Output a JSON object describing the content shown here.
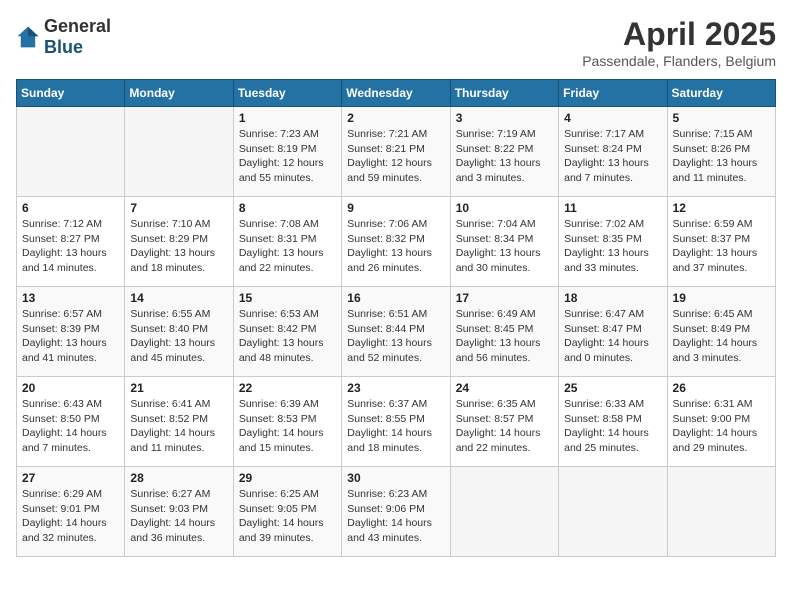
{
  "logo": {
    "general": "General",
    "blue": "Blue"
  },
  "title": "April 2025",
  "subtitle": "Passendale, Flanders, Belgium",
  "weekdays": [
    "Sunday",
    "Monday",
    "Tuesday",
    "Wednesday",
    "Thursday",
    "Friday",
    "Saturday"
  ],
  "weeks": [
    [
      {
        "day": "",
        "detail": ""
      },
      {
        "day": "",
        "detail": ""
      },
      {
        "day": "1",
        "detail": "Sunrise: 7:23 AM\nSunset: 8:19 PM\nDaylight: 12 hours\nand 55 minutes."
      },
      {
        "day": "2",
        "detail": "Sunrise: 7:21 AM\nSunset: 8:21 PM\nDaylight: 12 hours\nand 59 minutes."
      },
      {
        "day": "3",
        "detail": "Sunrise: 7:19 AM\nSunset: 8:22 PM\nDaylight: 13 hours\nand 3 minutes."
      },
      {
        "day": "4",
        "detail": "Sunrise: 7:17 AM\nSunset: 8:24 PM\nDaylight: 13 hours\nand 7 minutes."
      },
      {
        "day": "5",
        "detail": "Sunrise: 7:15 AM\nSunset: 8:26 PM\nDaylight: 13 hours\nand 11 minutes."
      }
    ],
    [
      {
        "day": "6",
        "detail": "Sunrise: 7:12 AM\nSunset: 8:27 PM\nDaylight: 13 hours\nand 14 minutes."
      },
      {
        "day": "7",
        "detail": "Sunrise: 7:10 AM\nSunset: 8:29 PM\nDaylight: 13 hours\nand 18 minutes."
      },
      {
        "day": "8",
        "detail": "Sunrise: 7:08 AM\nSunset: 8:31 PM\nDaylight: 13 hours\nand 22 minutes."
      },
      {
        "day": "9",
        "detail": "Sunrise: 7:06 AM\nSunset: 8:32 PM\nDaylight: 13 hours\nand 26 minutes."
      },
      {
        "day": "10",
        "detail": "Sunrise: 7:04 AM\nSunset: 8:34 PM\nDaylight: 13 hours\nand 30 minutes."
      },
      {
        "day": "11",
        "detail": "Sunrise: 7:02 AM\nSunset: 8:35 PM\nDaylight: 13 hours\nand 33 minutes."
      },
      {
        "day": "12",
        "detail": "Sunrise: 6:59 AM\nSunset: 8:37 PM\nDaylight: 13 hours\nand 37 minutes."
      }
    ],
    [
      {
        "day": "13",
        "detail": "Sunrise: 6:57 AM\nSunset: 8:39 PM\nDaylight: 13 hours\nand 41 minutes."
      },
      {
        "day": "14",
        "detail": "Sunrise: 6:55 AM\nSunset: 8:40 PM\nDaylight: 13 hours\nand 45 minutes."
      },
      {
        "day": "15",
        "detail": "Sunrise: 6:53 AM\nSunset: 8:42 PM\nDaylight: 13 hours\nand 48 minutes."
      },
      {
        "day": "16",
        "detail": "Sunrise: 6:51 AM\nSunset: 8:44 PM\nDaylight: 13 hours\nand 52 minutes."
      },
      {
        "day": "17",
        "detail": "Sunrise: 6:49 AM\nSunset: 8:45 PM\nDaylight: 13 hours\nand 56 minutes."
      },
      {
        "day": "18",
        "detail": "Sunrise: 6:47 AM\nSunset: 8:47 PM\nDaylight: 14 hours\nand 0 minutes."
      },
      {
        "day": "19",
        "detail": "Sunrise: 6:45 AM\nSunset: 8:49 PM\nDaylight: 14 hours\nand 3 minutes."
      }
    ],
    [
      {
        "day": "20",
        "detail": "Sunrise: 6:43 AM\nSunset: 8:50 PM\nDaylight: 14 hours\nand 7 minutes."
      },
      {
        "day": "21",
        "detail": "Sunrise: 6:41 AM\nSunset: 8:52 PM\nDaylight: 14 hours\nand 11 minutes."
      },
      {
        "day": "22",
        "detail": "Sunrise: 6:39 AM\nSunset: 8:53 PM\nDaylight: 14 hours\nand 15 minutes."
      },
      {
        "day": "23",
        "detail": "Sunrise: 6:37 AM\nSunset: 8:55 PM\nDaylight: 14 hours\nand 18 minutes."
      },
      {
        "day": "24",
        "detail": "Sunrise: 6:35 AM\nSunset: 8:57 PM\nDaylight: 14 hours\nand 22 minutes."
      },
      {
        "day": "25",
        "detail": "Sunrise: 6:33 AM\nSunset: 8:58 PM\nDaylight: 14 hours\nand 25 minutes."
      },
      {
        "day": "26",
        "detail": "Sunrise: 6:31 AM\nSunset: 9:00 PM\nDaylight: 14 hours\nand 29 minutes."
      }
    ],
    [
      {
        "day": "27",
        "detail": "Sunrise: 6:29 AM\nSunset: 9:01 PM\nDaylight: 14 hours\nand 32 minutes."
      },
      {
        "day": "28",
        "detail": "Sunrise: 6:27 AM\nSunset: 9:03 PM\nDaylight: 14 hours\nand 36 minutes."
      },
      {
        "day": "29",
        "detail": "Sunrise: 6:25 AM\nSunset: 9:05 PM\nDaylight: 14 hours\nand 39 minutes."
      },
      {
        "day": "30",
        "detail": "Sunrise: 6:23 AM\nSunset: 9:06 PM\nDaylight: 14 hours\nand 43 minutes."
      },
      {
        "day": "",
        "detail": ""
      },
      {
        "day": "",
        "detail": ""
      },
      {
        "day": "",
        "detail": ""
      }
    ]
  ]
}
